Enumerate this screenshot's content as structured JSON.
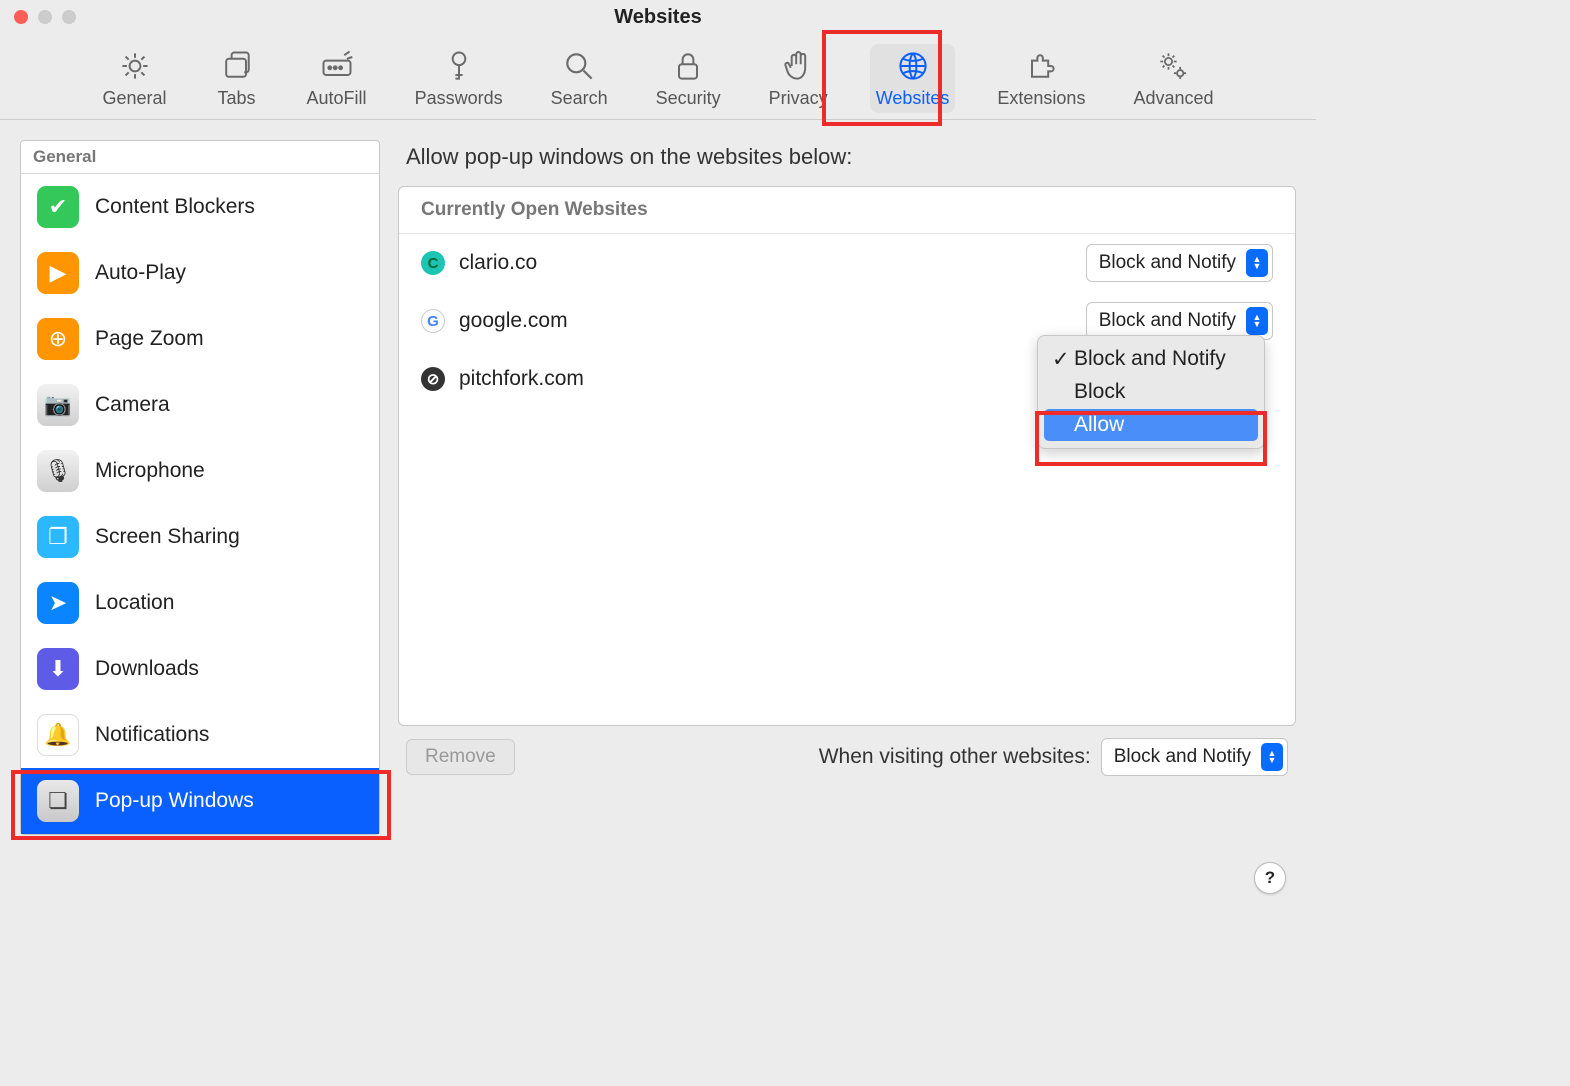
{
  "window": {
    "title": "Websites"
  },
  "toolbar": {
    "items": [
      {
        "id": "general",
        "label": "General"
      },
      {
        "id": "tabs",
        "label": "Tabs"
      },
      {
        "id": "autofill",
        "label": "AutoFill"
      },
      {
        "id": "passwords",
        "label": "Passwords"
      },
      {
        "id": "search",
        "label": "Search"
      },
      {
        "id": "security",
        "label": "Security"
      },
      {
        "id": "privacy",
        "label": "Privacy"
      },
      {
        "id": "websites",
        "label": "Websites"
      },
      {
        "id": "extensions",
        "label": "Extensions"
      },
      {
        "id": "advanced",
        "label": "Advanced"
      }
    ],
    "active": "websites"
  },
  "sidebar": {
    "header": "General",
    "items": [
      {
        "id": "content-blockers",
        "label": "Content Blockers",
        "icon": "shield",
        "bg": "#34c759"
      },
      {
        "id": "auto-play",
        "label": "Auto-Play",
        "icon": "play",
        "bg": "#ff9500"
      },
      {
        "id": "page-zoom",
        "label": "Page Zoom",
        "icon": "zoom",
        "bg": "#ff9500"
      },
      {
        "id": "camera",
        "label": "Camera",
        "icon": "camera",
        "bg": "linear-gradient(#f2f2f2,#cfcfcf)",
        "fg": "#333"
      },
      {
        "id": "microphone",
        "label": "Microphone",
        "icon": "mic",
        "bg": "linear-gradient(#f2f2f2,#cfcfcf)",
        "fg": "#333"
      },
      {
        "id": "screen-sharing",
        "label": "Screen Sharing",
        "icon": "screens",
        "bg": "#2bb8ff"
      },
      {
        "id": "location",
        "label": "Location",
        "icon": "arrow",
        "bg": "#0a84ff"
      },
      {
        "id": "downloads",
        "label": "Downloads",
        "icon": "download",
        "bg": "#5e5ce6"
      },
      {
        "id": "notifications",
        "label": "Notifications",
        "icon": "bell",
        "bg": "#ffffff",
        "fg": "#ff3b30",
        "border": "1px solid #ddd"
      },
      {
        "id": "popup-windows",
        "label": "Pop-up Windows",
        "icon": "windows",
        "bg": "linear-gradient(#e8e8e8,#c9c9c9)",
        "fg": "#444"
      }
    ],
    "selected": "popup-windows"
  },
  "main": {
    "title": "Allow pop-up windows on the websites below:",
    "subhead": "Currently Open Websites",
    "sites": [
      {
        "id": "clario",
        "name": "clario.co",
        "fav_bg": "#1bc4b3",
        "fav_text": "C",
        "fav_fg": "#063",
        "select": "Block and Notify"
      },
      {
        "id": "google",
        "name": "google.com",
        "fav_bg": "#ffffff",
        "fav_text": "G",
        "fav_fg": "#4285f4",
        "select": "Block and Notify"
      },
      {
        "id": "pitchfork",
        "name": "pitchfork.com",
        "fav_bg": "#333",
        "fav_text": "⊘",
        "fav_fg": "#fff",
        "select": "Block and Notify"
      }
    ],
    "dropdown": {
      "items": [
        {
          "label": "Block and Notify",
          "checked": true
        },
        {
          "label": "Block"
        },
        {
          "label": "Allow",
          "highlighted": true
        }
      ]
    },
    "remove_label": "Remove",
    "other_label": "When visiting other websites:",
    "other_select": "Block and Notify"
  },
  "help_label": "?"
}
